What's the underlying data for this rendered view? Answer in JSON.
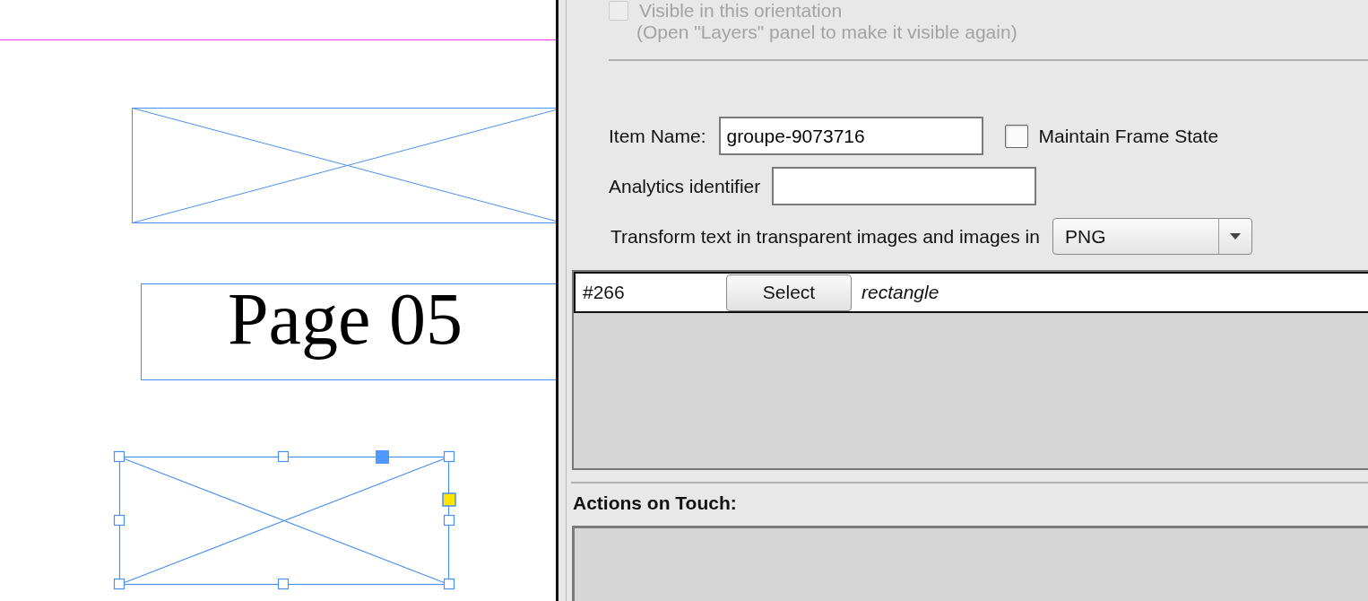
{
  "canvas": {
    "page_label": "Page 05"
  },
  "panel": {
    "visibility": {
      "label": "Visible in this orientation",
      "checked": false,
      "disabled": true,
      "hint": "(Open \"Layers\" panel to make it visible again)"
    },
    "item_name": {
      "label": "Item Name:",
      "value": "groupe-9073716"
    },
    "maintain_frame_state": {
      "label": "Maintain Frame State",
      "checked": false
    },
    "analytics": {
      "label": "Analytics identifier"
    },
    "transform": {
      "label": "Transform text in transparent images and images in",
      "value": "PNG"
    },
    "objects": [
      {
        "id": "#266",
        "button": "Select",
        "type": "rectangle"
      }
    ],
    "actions_title": "Actions on Touch:"
  }
}
